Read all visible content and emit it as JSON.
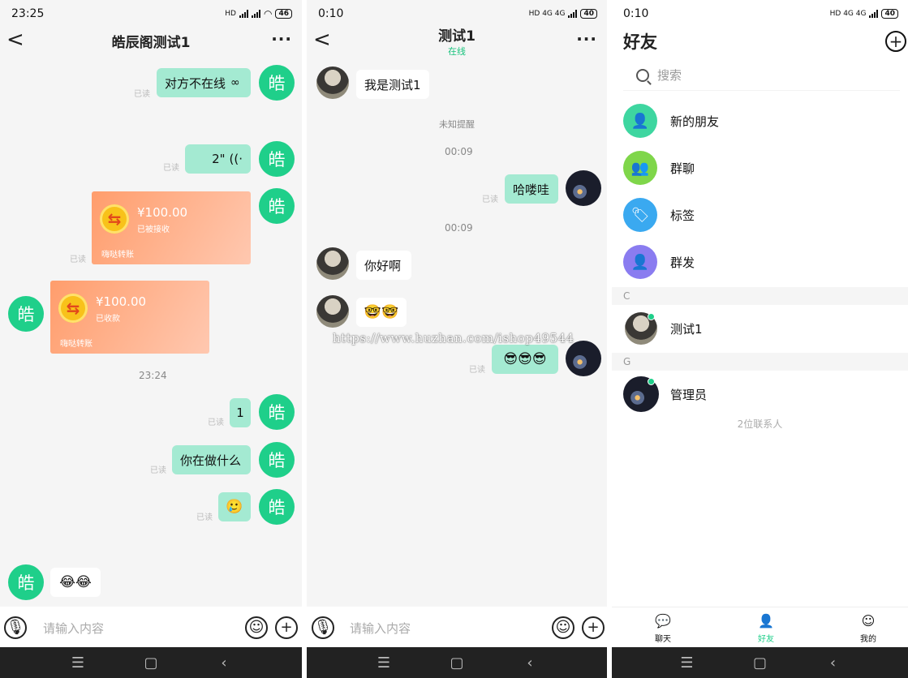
{
  "screen1": {
    "status": {
      "time": "23:25",
      "sig": "HD",
      "battery": "46"
    },
    "title": "皓辰阁测试1",
    "more": "···",
    "back": "<",
    "avatar_char": "皓",
    "read": "已读",
    "msg1": "对方不在线",
    "voice": "2\"",
    "transfer1": {
      "amount": "¥100.00",
      "status": "已被接收",
      "footer": "嗨哒转账",
      "coin": "⇆"
    },
    "transfer2": {
      "amount": "¥100.00",
      "status": "已收款",
      "footer": "嗨哒转账",
      "coin": "⇆"
    },
    "time1": "23:24",
    "msg2": "1",
    "msg3": "你在做什么",
    "msg4": "🥲",
    "msg5": "😂😂",
    "placeholder": "请输入内容"
  },
  "screen2": {
    "status": {
      "time": "0:10",
      "sig": "HD 4G 4G",
      "battery": "40"
    },
    "title": "测试1",
    "subtitle": "在线",
    "more": "···",
    "back": "<",
    "read": "已读",
    "msg1": "我是测试1",
    "notice": "未知提醒",
    "time1": "00:09",
    "msg2": "哈喽哇",
    "time2": "00:09",
    "msg3": "你好啊",
    "msg4": "🤓🤓",
    "msg5": "😎😎😎",
    "placeholder": "请输入内容",
    "watermark": "https://www.huzhan.com/ishop49544"
  },
  "screen3": {
    "status": {
      "time": "0:10",
      "sig": "HD 4G 4G",
      "battery": "40"
    },
    "title": "好友",
    "search_placeholder": "搜索",
    "items": [
      {
        "label": "新的朋友",
        "color": "#3ed6a0"
      },
      {
        "label": "群聊",
        "color": "#7fd64a"
      },
      {
        "label": "标签",
        "color": "#3aa9f0"
      },
      {
        "label": "群发",
        "color": "#8a7cf0"
      }
    ],
    "section_c": "C",
    "contact1": "测试1",
    "section_g": "G",
    "contact2": "管理员",
    "count": "2位联系人",
    "tabs": [
      {
        "label": "聊天"
      },
      {
        "label": "好友"
      },
      {
        "label": "我的"
      }
    ]
  },
  "sysnav": {
    "menu": "☰",
    "home": "▢",
    "back": "‹"
  }
}
